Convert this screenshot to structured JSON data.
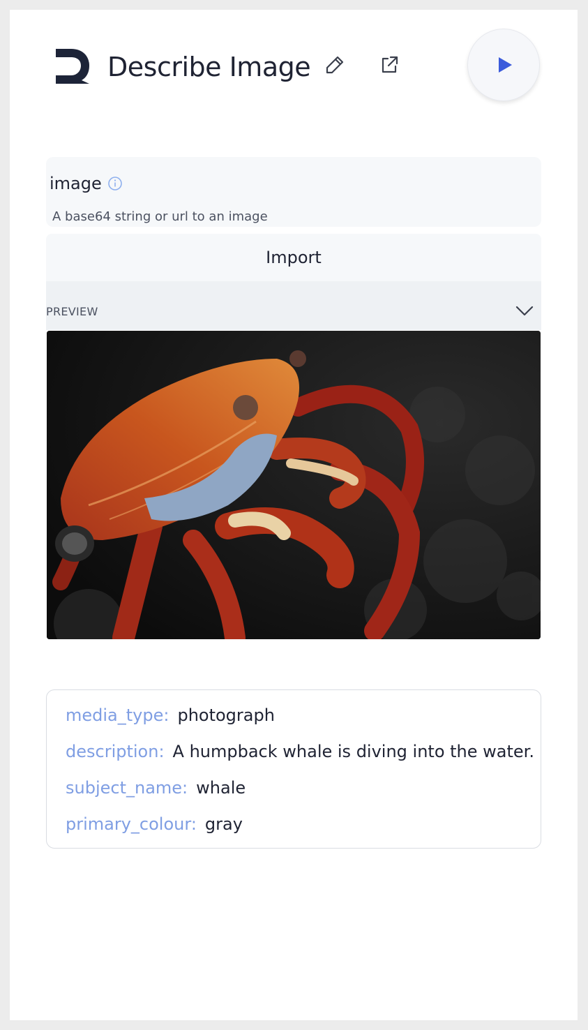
{
  "header": {
    "title": "Describe Image",
    "icons": [
      "logo-icon",
      "edit-icon",
      "external-link-icon",
      "play-icon"
    ]
  },
  "input": {
    "label": "image",
    "hint": "A base64 string or url to an image",
    "import_label": "Import",
    "preview_label": "PREVIEW"
  },
  "result": {
    "fields": [
      {
        "key": "media_type:",
        "value": "photograph"
      },
      {
        "key": "description:",
        "value": "A humpback whale is diving into the water."
      },
      {
        "key": "subject_name:",
        "value": "whale"
      },
      {
        "key": "primary_colour:",
        "value": "gray"
      }
    ]
  },
  "colors": {
    "accent": "#3b5bdb",
    "key_text": "#7f9ee3",
    "text": "#1f2333"
  }
}
